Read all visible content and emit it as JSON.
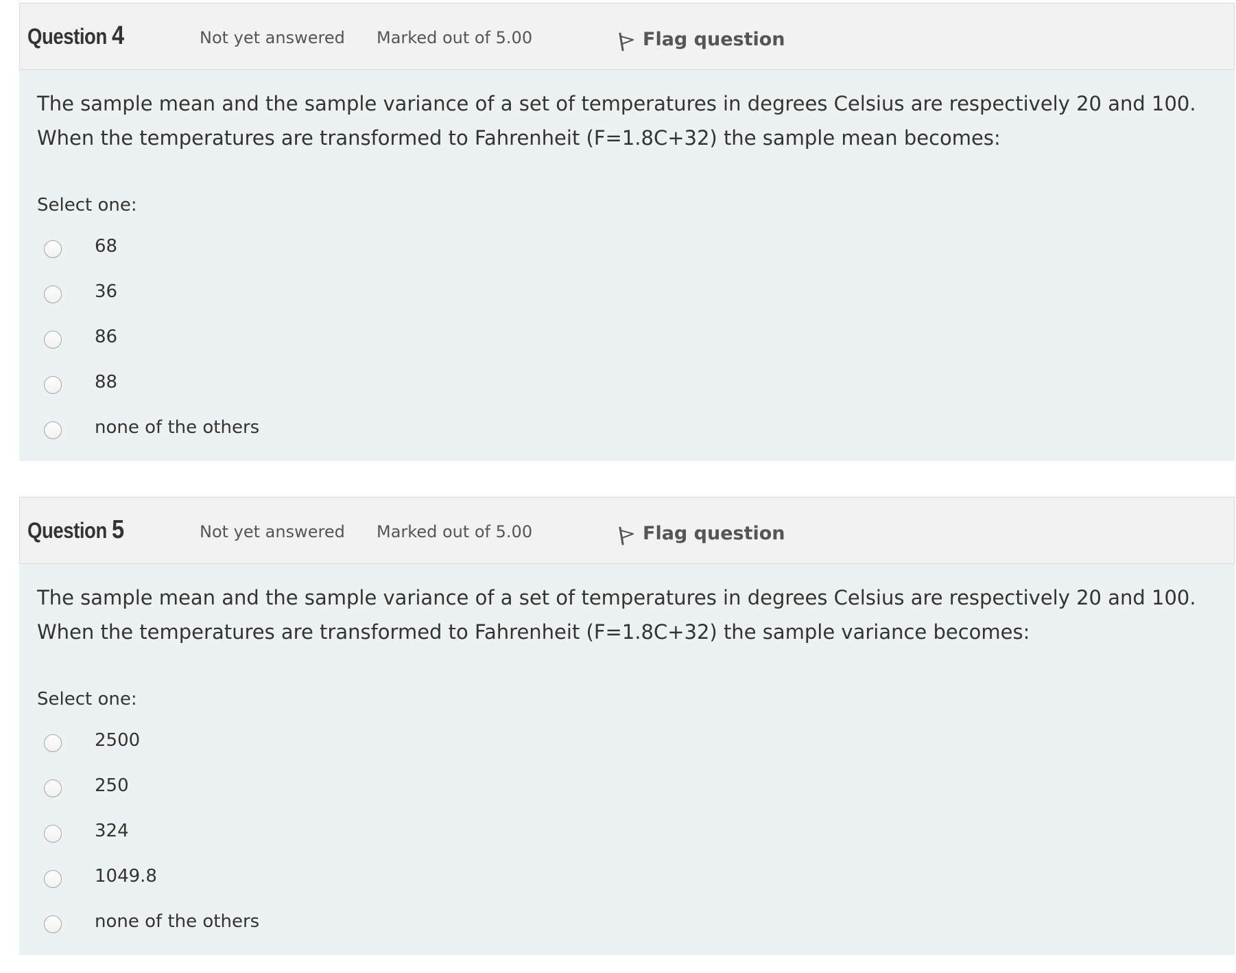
{
  "questions": [
    {
      "title_prefix": "Question",
      "number": "4",
      "state": "Not yet answered",
      "grade": "Marked out of 5.00",
      "flag_label": "Flag question",
      "text_line1": "The sample mean and the sample variance of a set of temperatures in degrees Celsius are respectively 20 and 100.",
      "text_line2": "When the temperatures are transformed to Fahrenheit (F=1.8C+32) the sample mean becomes:",
      "prompt": "Select one:",
      "options": [
        "68",
        "36",
        "86",
        "88",
        "none of the others"
      ]
    },
    {
      "title_prefix": "Question",
      "number": "5",
      "state": "Not yet answered",
      "grade": "Marked out of 5.00",
      "flag_label": "Flag question",
      "text_line1": "The sample mean and the sample variance of a set of temperatures in degrees Celsius are respectively 20 and 100.",
      "text_line2": "When the temperatures are transformed to Fahrenheit (F=1.8C+32) the sample variance becomes:",
      "prompt": "Select one:",
      "options": [
        "2500",
        "250",
        "324",
        "1049.8",
        "none of the others"
      ]
    }
  ],
  "icons": {
    "flag": "flag-icon",
    "radio": "radio-unchecked"
  },
  "colors": {
    "header_bg": "#f2f2f2",
    "body_bg": "#ecf1f1",
    "text": "#333333",
    "muted": "#555555"
  }
}
